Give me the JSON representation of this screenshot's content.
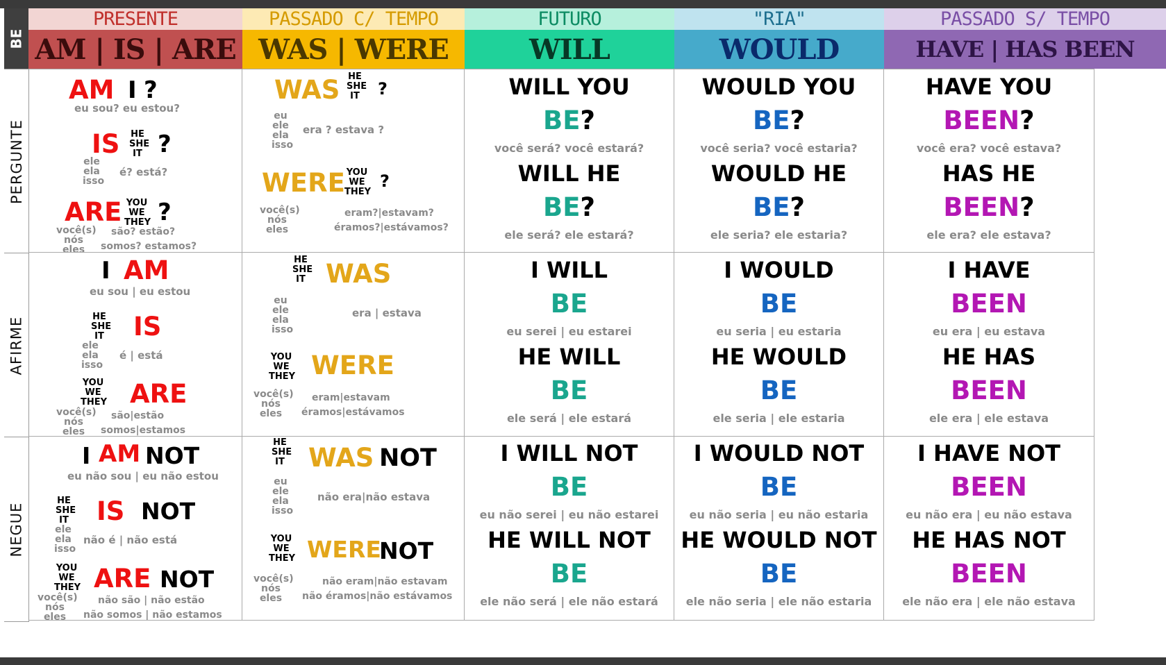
{
  "side": {
    "be": "BE",
    "rows": [
      "PERGUNTE",
      "AFIRME",
      "NEGUE"
    ]
  },
  "colors": {
    "presente": "#c05050",
    "passado": "#f6b800",
    "futuro": "#1fd29a",
    "ria": "#46aacb",
    "perfect": "#8f68b3",
    "red": "#ee1111",
    "gold": "#e3a61a",
    "teal": "#1aa68e",
    "blue": "#1565c0",
    "purple": "#b317b3"
  },
  "headers": [
    {
      "sub": "PRESENTE",
      "main": "AM | IS | ARE"
    },
    {
      "sub": "PASSADO C/ TEMPO",
      "main": "WAS | WERE"
    },
    {
      "sub": "FUTURO",
      "main": "WILL"
    },
    {
      "sub": "\"RIA\"",
      "main": "WOULD"
    },
    {
      "sub": "PASSADO S/ TEMPO",
      "main": "HAVE | HAS BEEN"
    }
  ],
  "common": {
    "q": "?",
    "not": "NOT",
    "i": "I",
    "he_she_it": "HE SHE IT",
    "you_we_they": "YOU WE THEY",
    "ele_ela_isso": "ele ela isso",
    "eu_ele_ela_isso": "eu ele ela isso",
    "voces_nos_eles": "você(s) nós eles"
  },
  "presente": {
    "q": {
      "am": "AM",
      "am_tr": "eu sou? eu estou?",
      "is": "IS",
      "is_tr": "é? está?",
      "are": "ARE",
      "are_tr1": "são? estão?",
      "are_tr2": "somos? estamos?"
    },
    "a": {
      "am": "AM",
      "am_tr": "eu sou | eu estou",
      "is": "IS",
      "is_tr": "é | está",
      "are": "ARE",
      "are_tr1": "são|estão",
      "are_tr2": "somos|estamos"
    },
    "n": {
      "am": "AM",
      "am_tr": "eu não sou | eu não estou",
      "is": "IS",
      "is_tr": "não é | não está",
      "are": "ARE",
      "are_tr1": "não são | não estão",
      "are_tr2": "não somos | não estamos"
    }
  },
  "passado": {
    "q": {
      "was": "WAS",
      "was_tr": "era ? estava ?",
      "were": "WERE",
      "were_tr1": "eram?|estavam?",
      "were_tr2": "éramos?|estávamos?"
    },
    "a": {
      "was": "WAS",
      "was_tr": "era | estava",
      "were": "WERE",
      "were_tr1": "eram|estavam",
      "were_tr2": "éramos|estávamos"
    },
    "n": {
      "was": "WAS",
      "was_tr": "não era|não estava",
      "were": "WERE",
      "were_tr1": "não eram|não estavam",
      "were_tr2": "não éramos|não estávamos"
    }
  },
  "futuro": {
    "q": {
      "l1": "WILL YOU",
      "b1": "BE",
      "t1": "você será? você estará?",
      "l2": "WILL HE",
      "b2": "BE",
      "t2": "ele será? ele estará?"
    },
    "a": {
      "l1": "I WILL",
      "b1": "BE",
      "t1": "eu serei | eu estarei",
      "l2": "HE WILL",
      "b2": "BE",
      "t2": "ele será | ele estará"
    },
    "n": {
      "l1": "I WILL NOT",
      "b1": "BE",
      "t1": "eu não serei | eu não estarei",
      "l2": "HE WILL NOT",
      "b2": "BE",
      "t2": "ele não será | ele não estará"
    }
  },
  "ria": {
    "q": {
      "l1": "WOULD YOU",
      "b1": "BE",
      "t1": "você seria? você estaria?",
      "l2": "WOULD HE",
      "b2": "BE",
      "t2": "ele seria? ele estaria?"
    },
    "a": {
      "l1": "I WOULD",
      "b1": "BE",
      "t1": "eu seria | eu estaria",
      "l2": "HE WOULD",
      "b2": "BE",
      "t2": "ele seria | ele estaria"
    },
    "n": {
      "l1": "I WOULD NOT",
      "b1": "BE",
      "t1": "eu não seria | eu não estaria",
      "l2": "HE WOULD NOT",
      "b2": "BE",
      "t2": "ele não seria | ele não estaria"
    }
  },
  "perfect": {
    "q": {
      "l1": "HAVE YOU",
      "b1": "BEEN",
      "t1": "você era? você estava?",
      "l2": "HAS HE",
      "b2": "BEEN",
      "t2": "ele era? ele estava?"
    },
    "a": {
      "l1": "I HAVE",
      "b1": "BEEN",
      "t1": "eu era | eu estava",
      "l2": "HE HAS",
      "b2": "BEEN",
      "t2": "ele era | ele estava"
    },
    "n": {
      "l1": "I HAVE NOT",
      "b1": "BEEN",
      "t1": "eu não era | eu não estava",
      "l2": "HE HAS NOT",
      "b2": "BEEN",
      "t2": "ele não era | ele não estava"
    }
  }
}
